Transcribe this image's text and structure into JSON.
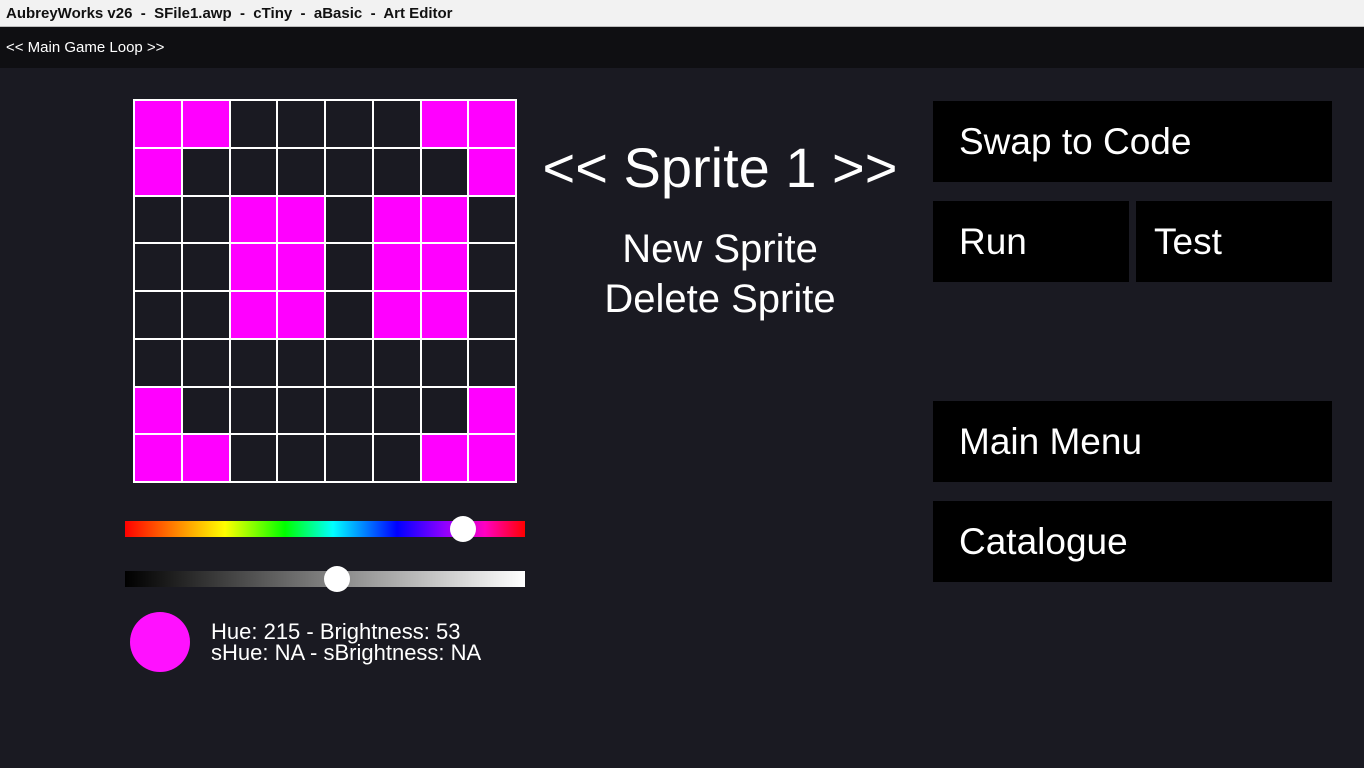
{
  "window": {
    "title": "AubreyWorks v26  -  SFile1.awp  -  cTiny  -  aBasic  -  Art Editor"
  },
  "breadcrumb": {
    "label": "<< Main Game Loop >>"
  },
  "sprite": {
    "nav_label": "<< Sprite 1 >>",
    "new_label": "New Sprite",
    "delete_label": "Delete Sprite",
    "pixels": [
      [
        1,
        1,
        0,
        0,
        0,
        0,
        1,
        1
      ],
      [
        1,
        0,
        0,
        0,
        0,
        0,
        0,
        1
      ],
      [
        0,
        0,
        1,
        1,
        0,
        1,
        1,
        0
      ],
      [
        0,
        0,
        1,
        1,
        0,
        1,
        1,
        0
      ],
      [
        0,
        0,
        1,
        1,
        0,
        1,
        1,
        0
      ],
      [
        0,
        0,
        0,
        0,
        0,
        0,
        0,
        0
      ],
      [
        1,
        0,
        0,
        0,
        0,
        0,
        0,
        1
      ],
      [
        1,
        1,
        0,
        0,
        0,
        0,
        1,
        1
      ]
    ],
    "pixel_color": "#ff00ff",
    "empty_color": "#1a1a22"
  },
  "color_picker": {
    "hue_slider_fraction": 0.845,
    "brightness_slider_fraction": 0.53,
    "swatch_color": "#ff11ff",
    "hue_text": "Hue: 215 - Brightness: 53",
    "shue_text": "sHue: NA - sBrightness: NA"
  },
  "buttons": {
    "swap_to_code": "Swap to Code",
    "run": "Run",
    "test": "Test",
    "main_menu": "Main Menu",
    "catalogue": "Catalogue"
  }
}
